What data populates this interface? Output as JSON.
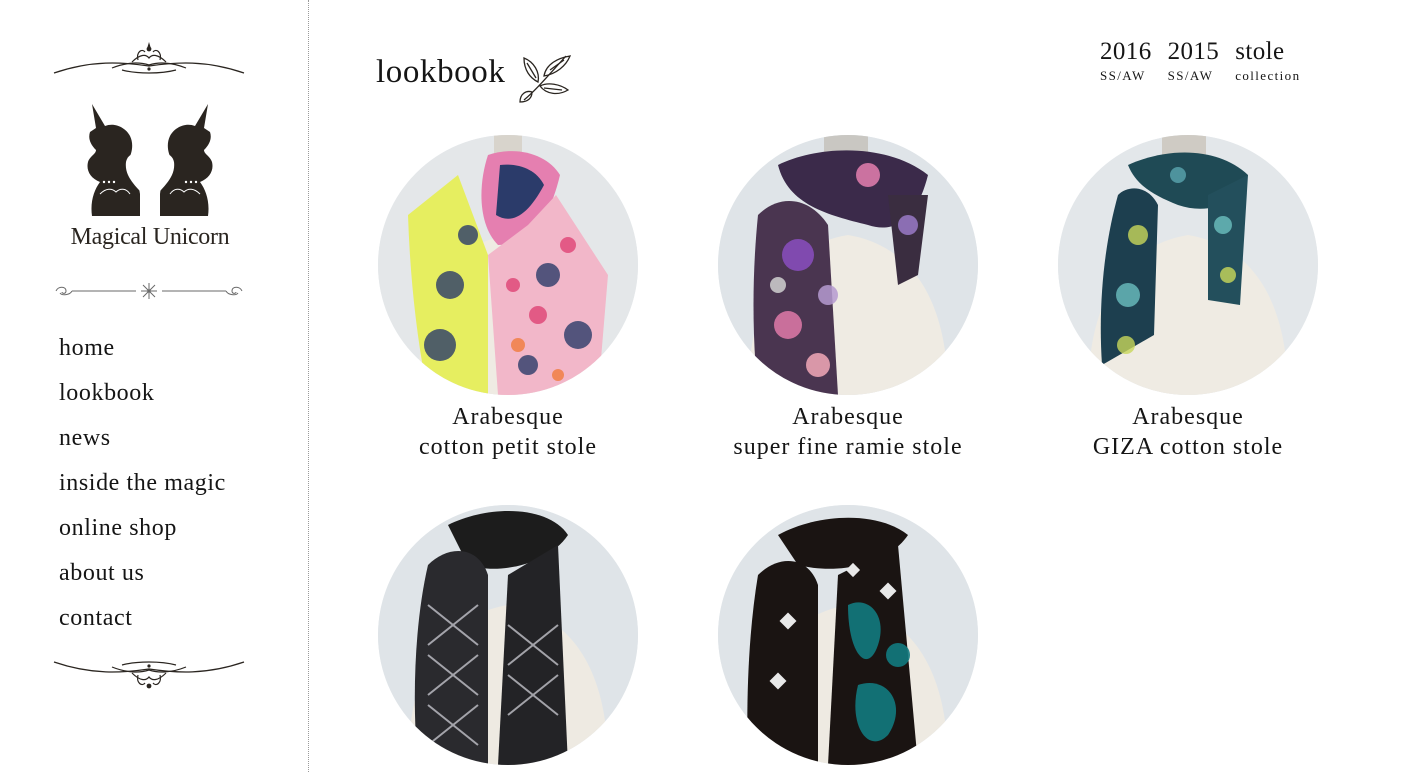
{
  "brand": {
    "name": "Magical Unicorn"
  },
  "nav": {
    "items": [
      {
        "label": "home"
      },
      {
        "label": "lookbook"
      },
      {
        "label": "news"
      },
      {
        "label": "inside the magic"
      },
      {
        "label": "online shop"
      },
      {
        "label": "about us"
      },
      {
        "label": "contact"
      }
    ]
  },
  "page": {
    "title": "lookbook"
  },
  "collections": [
    {
      "big": "2016",
      "small": "SS/AW"
    },
    {
      "big": "2015",
      "small": "SS/AW"
    },
    {
      "big": "stole",
      "small": "collection"
    }
  ],
  "products": [
    {
      "line1": "Arabesque",
      "line2": "cotton petit stole"
    },
    {
      "line1": "Arabesque",
      "line2": "super fine ramie stole"
    },
    {
      "line1": "Arabesque",
      "line2": "GIZA cotton stole"
    },
    {
      "line1": "",
      "line2": ""
    },
    {
      "line1": "",
      "line2": ""
    }
  ],
  "colors": {
    "text": "#151515",
    "divider": "#9a9a9a",
    "background": "#ffffff"
  }
}
